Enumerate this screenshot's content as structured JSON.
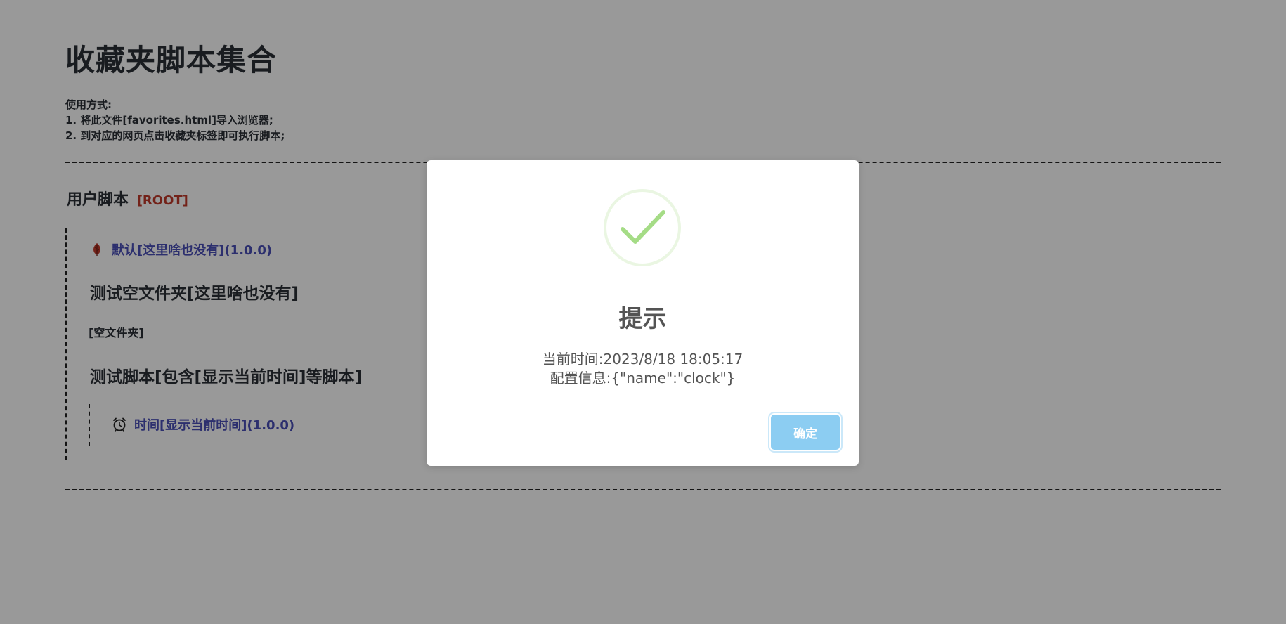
{
  "page": {
    "title": "收藏夹脚本集合",
    "usage": {
      "heading": "使用方式:",
      "steps": [
        "1. 将此文件[favorites.html]导入浏览器;",
        "2. 到对应的网页点击收藏夹标签即可执行脚本;"
      ]
    }
  },
  "user_scripts": {
    "heading": "用户脚本",
    "root_tag": "[ROOT]",
    "default_script": {
      "label": "默认[这里啥也没有](1.0.0)",
      "icon": "leaf-icon",
      "icon_color": "#c0392b"
    },
    "folder_empty": {
      "title": "测试空文件夹[这里啥也没有]",
      "empty_label": "[空文件夹]"
    },
    "folder_test": {
      "title": "测试脚本[包含[显示当前时间]等脚本]",
      "items": [
        {
          "label": "时间[显示当前时间](1.0.0)",
          "icon": "alarm-clock-icon"
        }
      ]
    }
  },
  "modal": {
    "icon": "success-check-icon",
    "icon_color": "#a5dc86",
    "title": "提示",
    "content_lines": [
      "当前时间:2023/8/18 18:05:17",
      "配置信息:{\"name\":\"clock\"}"
    ],
    "confirm_label": "确定",
    "confirm_color": "#8ccdf2"
  },
  "colors": {
    "link": "#4a4fb8",
    "root_tag": "#c0392b",
    "overlay": "rgba(0,0,0,0.4)"
  }
}
